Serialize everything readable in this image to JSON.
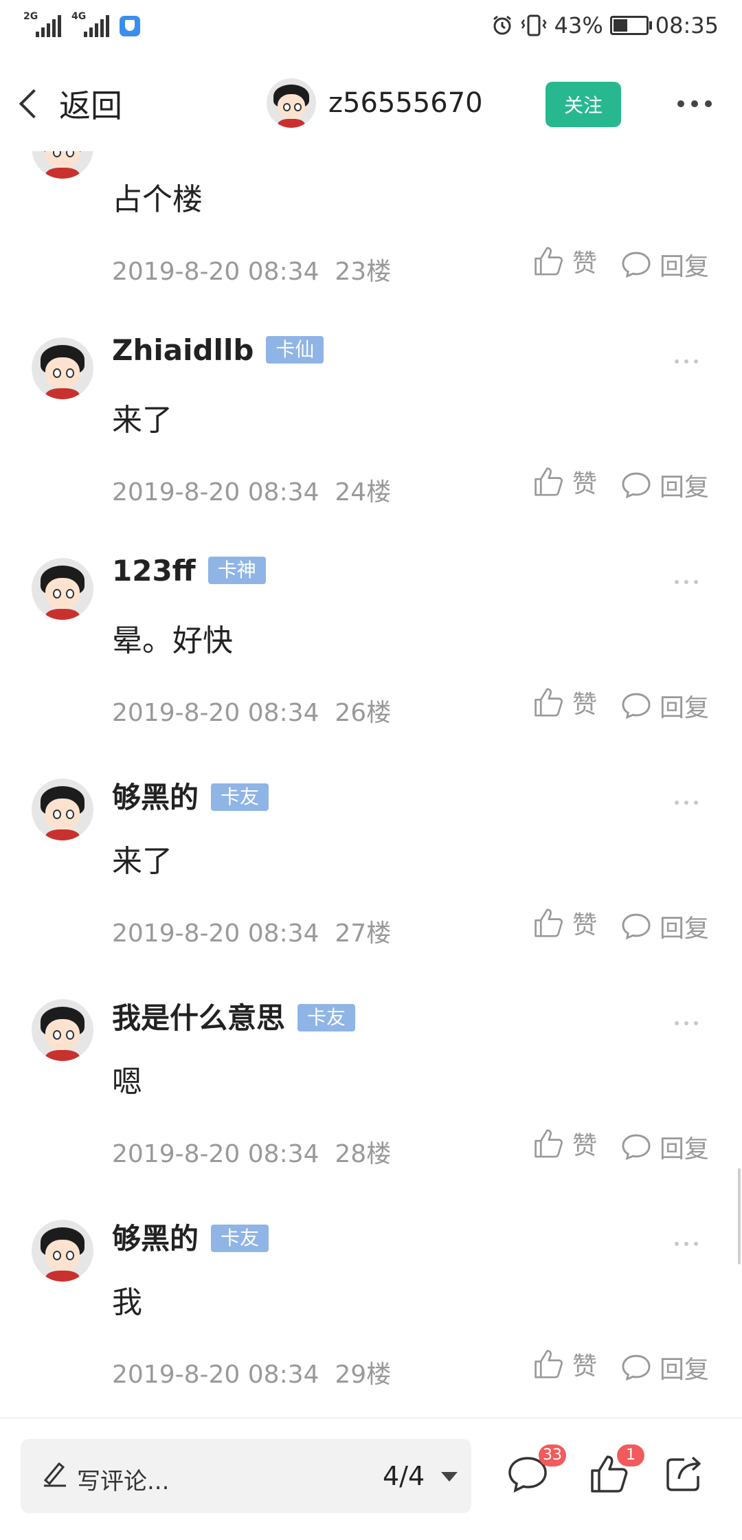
{
  "status_bar": {
    "sim1_tag": "2G",
    "sim2_tag": "4G",
    "battery_pct": "43%",
    "time": "08:35",
    "battery_level": 0.43
  },
  "navbar": {
    "back_label": "返回",
    "username": "z56555670",
    "follow_label": "关注"
  },
  "comments": [
    {
      "name": "",
      "badge": "",
      "text": "占个楼",
      "time": "2019-8-20 08:34",
      "floor": "23楼",
      "like_label": "赞",
      "reply_label": "回复"
    },
    {
      "name": "Zhiaidllb",
      "badge": "卡仙",
      "text": "来了",
      "time": "2019-8-20 08:34",
      "floor": "24楼",
      "like_label": "赞",
      "reply_label": "回复"
    },
    {
      "name": "123ff",
      "badge": "卡神",
      "text": "晕。好快",
      "time": "2019-8-20 08:34",
      "floor": "26楼",
      "like_label": "赞",
      "reply_label": "回复"
    },
    {
      "name": "够黑的",
      "badge": "卡友",
      "text": "来了",
      "time": "2019-8-20 08:34",
      "floor": "27楼",
      "like_label": "赞",
      "reply_label": "回复"
    },
    {
      "name": "我是什么意思",
      "badge": "卡友",
      "text": "嗯",
      "time": "2019-8-20 08:34",
      "floor": "28楼",
      "like_label": "赞",
      "reply_label": "回复"
    },
    {
      "name": "够黑的",
      "badge": "卡友",
      "text": "我",
      "time": "2019-8-20 08:34",
      "floor": "29楼",
      "like_label": "赞",
      "reply_label": "回复"
    }
  ],
  "bottom_bar": {
    "placeholder": "写评论...",
    "page_indicator": "4/4",
    "comment_count": "33",
    "like_count": "1"
  },
  "colors": {
    "follow_button": "#27b88f",
    "badge": "#8fb4e6",
    "notification_badge": "#f25b5b"
  }
}
